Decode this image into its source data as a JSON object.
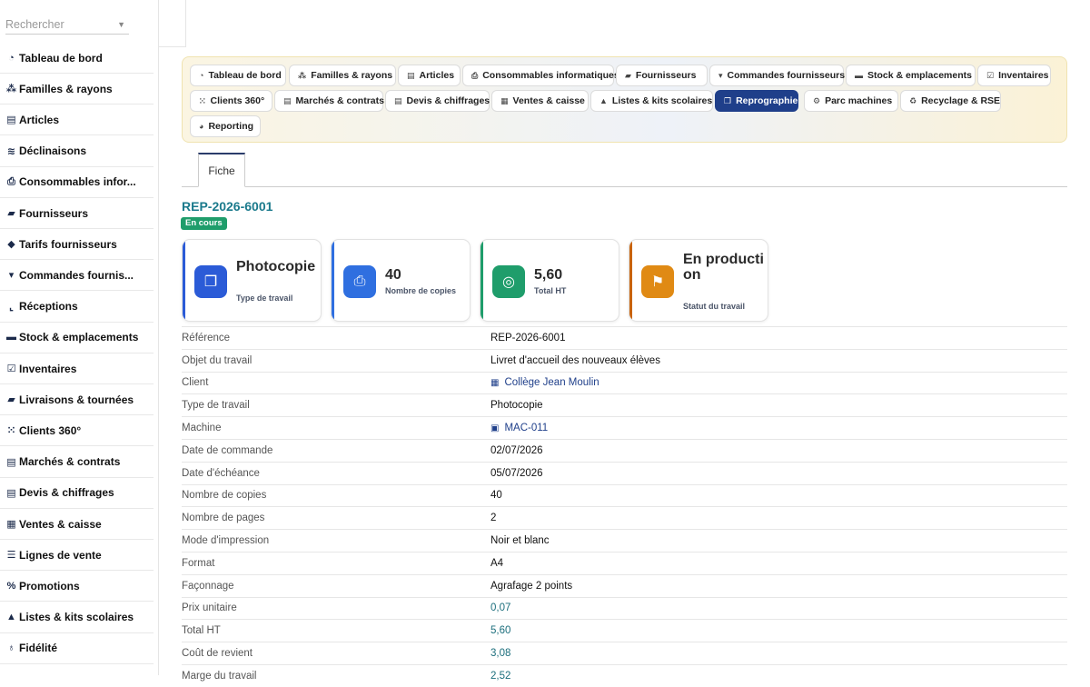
{
  "sidebar": {
    "search_placeholder": "Rechercher",
    "items": [
      {
        "icon": "gauge-icon",
        "glyph": "◔",
        "label": "Tableau de bord"
      },
      {
        "icon": "sitemap-icon",
        "glyph": "⁂",
        "label": "Familles & rayons"
      },
      {
        "icon": "article-icon",
        "glyph": "▤",
        "label": "Articles"
      },
      {
        "icon": "layers-icon",
        "glyph": "≋",
        "label": "Déclinaisons"
      },
      {
        "icon": "printer-icon",
        "glyph": "⎙",
        "label": "Consommables infor..."
      },
      {
        "icon": "truck-loading-icon",
        "glyph": "▰",
        "label": "Fournisseurs"
      },
      {
        "icon": "tags-icon",
        "glyph": "◆",
        "label": "Tarifs fournisseurs"
      },
      {
        "icon": "cart-icon",
        "glyph": "▾",
        "label": "Commandes fournis..."
      },
      {
        "icon": "dolly-icon",
        "glyph": "⌞",
        "label": "Réceptions"
      },
      {
        "icon": "warehouse-icon",
        "glyph": "▬",
        "label": "Stock & emplacements"
      },
      {
        "icon": "clipboard-check-icon",
        "glyph": "☑",
        "label": "Inventaires"
      },
      {
        "icon": "truck-icon",
        "glyph": "▰",
        "label": "Livraisons & tournées"
      },
      {
        "icon": "users-icon",
        "glyph": "⁙",
        "label": "Clients 360°"
      },
      {
        "icon": "contract-icon",
        "glyph": "▤",
        "label": "Marchés & contrats"
      },
      {
        "icon": "invoice-icon",
        "glyph": "▤",
        "label": "Devis & chiffrages"
      },
      {
        "icon": "cash-register-icon",
        "glyph": "▦",
        "label": "Ventes & caisse"
      },
      {
        "icon": "list-icon",
        "glyph": "☰",
        "label": "Lignes de vente"
      },
      {
        "icon": "percent-icon",
        "glyph": "%",
        "label": "Promotions"
      },
      {
        "icon": "graduation-cap-icon",
        "glyph": "▲",
        "label": "Listes & kits scolaires"
      },
      {
        "icon": "award-icon",
        "glyph": "♁",
        "label": "Fidélité"
      }
    ]
  },
  "nav": {
    "buttons": [
      {
        "icon": "gauge-icon",
        "glyph": "◔",
        "label": "Tableau de bord",
        "active": false
      },
      {
        "icon": "sitemap-icon",
        "glyph": "⁂",
        "label": "Familles & rayons",
        "active": false
      },
      {
        "icon": "article-icon",
        "glyph": "▤",
        "label": "Articles",
        "active": false
      },
      {
        "icon": "printer-icon",
        "glyph": "⎙",
        "label": "Consommables informatiques",
        "active": false
      },
      {
        "icon": "truck-loading-icon",
        "glyph": "▰",
        "label": "Fournisseurs",
        "active": false
      },
      {
        "icon": "cart-icon",
        "glyph": "▾",
        "label": "Commandes fournisseurs",
        "active": false
      },
      {
        "icon": "warehouse-icon",
        "glyph": "▬",
        "label": "Stock & emplacements",
        "active": false
      },
      {
        "icon": "clipboard-check-icon",
        "glyph": "☑",
        "label": "Inventaires",
        "active": false
      },
      {
        "icon": "users-icon",
        "glyph": "⁙",
        "label": "Clients 360°",
        "active": false
      },
      {
        "icon": "contract-icon",
        "glyph": "▤",
        "label": "Marchés & contrats",
        "active": false
      },
      {
        "icon": "invoice-icon",
        "glyph": "▤",
        "label": "Devis & chiffrages",
        "active": false
      },
      {
        "icon": "cash-register-icon",
        "glyph": "▦",
        "label": "Ventes & caisse",
        "active": false
      },
      {
        "icon": "graduation-cap-icon",
        "glyph": "▲",
        "label": "Listes & kits scolaires",
        "active": false
      },
      {
        "icon": "copy-icon",
        "glyph": "❐",
        "label": "Reprographie",
        "active": true
      },
      {
        "icon": "gears-icon",
        "glyph": "⚙",
        "label": "Parc machines",
        "active": false
      },
      {
        "icon": "recycle-icon",
        "glyph": "♻",
        "label": "Recyclage & RSE",
        "active": false
      },
      {
        "icon": "chart-pie-icon",
        "glyph": "◕",
        "label": "Reporting",
        "active": false
      }
    ]
  },
  "tabs": {
    "fiche": "Fiche"
  },
  "record": {
    "reference": "REP-2026-6001",
    "status_badge": "En cours"
  },
  "cards": [
    {
      "icon": "copy-icon",
      "glyph": "❐",
      "value": "Photocopie",
      "caption": "Type de travail",
      "color": "#2b5bd7",
      "bar": "#2b5bd7"
    },
    {
      "icon": "printer-icon",
      "glyph": "⎙",
      "value": "40",
      "caption": "Nombre de copies",
      "color": "#2f6fe0",
      "bar": "#2f6fe0"
    },
    {
      "icon": "coins-icon",
      "glyph": "◎",
      "value": "5,60",
      "caption": "Total HT",
      "color": "#1f9d6b",
      "bar": "#1f9d6b"
    },
    {
      "icon": "flag-icon",
      "glyph": "⚑",
      "value": "En production",
      "caption": "Statut du travail",
      "color": "#e08a14",
      "bar": "#c9630a"
    }
  ],
  "details": [
    {
      "key": "Référence",
      "value": "REP-2026-6001",
      "style": "plain"
    },
    {
      "key": "Objet du travail",
      "value": "Livret d'accueil des nouveaux élèves",
      "style": "plain"
    },
    {
      "key": "Client",
      "value": "Collège Jean Moulin",
      "style": "link",
      "icon": "building-icon",
      "glyph": "▦"
    },
    {
      "key": "Type de travail",
      "value": "Photocopie",
      "style": "plain"
    },
    {
      "key": "Machine",
      "value": "MAC-011",
      "style": "link",
      "icon": "machine-icon",
      "glyph": "▣"
    },
    {
      "key": "Date de commande",
      "value": "02/07/2026",
      "style": "plain"
    },
    {
      "key": "Date d'échéance",
      "value": "05/07/2026",
      "style": "plain"
    },
    {
      "key": "Nombre de copies",
      "value": "40",
      "style": "plain"
    },
    {
      "key": "Nombre de pages",
      "value": "2",
      "style": "plain"
    },
    {
      "key": "Mode d'impression",
      "value": "Noir et blanc",
      "style": "plain"
    },
    {
      "key": "Format",
      "value": "A4",
      "style": "plain"
    },
    {
      "key": "Façonnage",
      "value": "Agrafage 2 points",
      "style": "plain"
    },
    {
      "key": "Prix unitaire",
      "value": "0,07",
      "style": "num"
    },
    {
      "key": "Total HT",
      "value": "5,60",
      "style": "num"
    },
    {
      "key": "Coût de revient",
      "value": "3,08",
      "style": "num"
    },
    {
      "key": "Marge du travail",
      "value": "2,52",
      "style": "num"
    }
  ]
}
